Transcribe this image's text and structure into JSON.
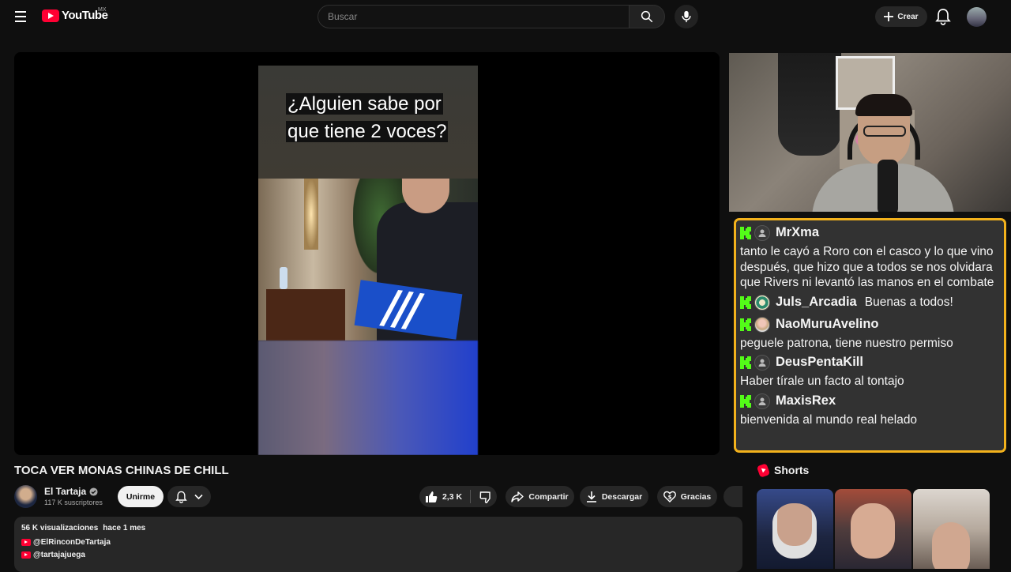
{
  "header": {
    "logo_text": "YouTube",
    "country": "MX",
    "search_placeholder": "Buscar",
    "create_label": "Crear"
  },
  "video": {
    "caption_line1": "¿Alguien sabe por",
    "caption_line2": "que tiene 2 voces?",
    "title": "TOCA VER MONAS CHINAS DE CHILL"
  },
  "channel": {
    "name": "El Tartaja",
    "subscribers": "117 K suscriptores",
    "join_label": "Unirme"
  },
  "actions": {
    "likes": "2,3 K",
    "share": "Compartir",
    "download": "Descargar",
    "thanks": "Gracias"
  },
  "description": {
    "views": "56 K visualizaciones",
    "date": "hace 1 mes",
    "links": [
      "@ElRinconDeTartaja",
      "@tartajajuega"
    ]
  },
  "chat": {
    "border_color": "#f3b21c",
    "kick_color": "#53fc18",
    "messages": [
      {
        "user": "MrXma",
        "text": "tanto le cayó a Roro con el casco y lo que vino después, que hizo que a todos se nos olvidara que Rivers ni levantó las manos en el combate"
      },
      {
        "user": "Juls_Arcadia",
        "text": "Buenas a todos!"
      },
      {
        "user": "NaoMuruAvelino",
        "text": "peguele patrona, tiene nuestro permiso"
      },
      {
        "user": "DeusPentaKill",
        "text": "Haber tírale un facto al tontajo"
      },
      {
        "user": "MaxisRex",
        "text": "bienvenida al mundo real helado"
      }
    ]
  },
  "shorts": {
    "heading": "Shorts"
  }
}
